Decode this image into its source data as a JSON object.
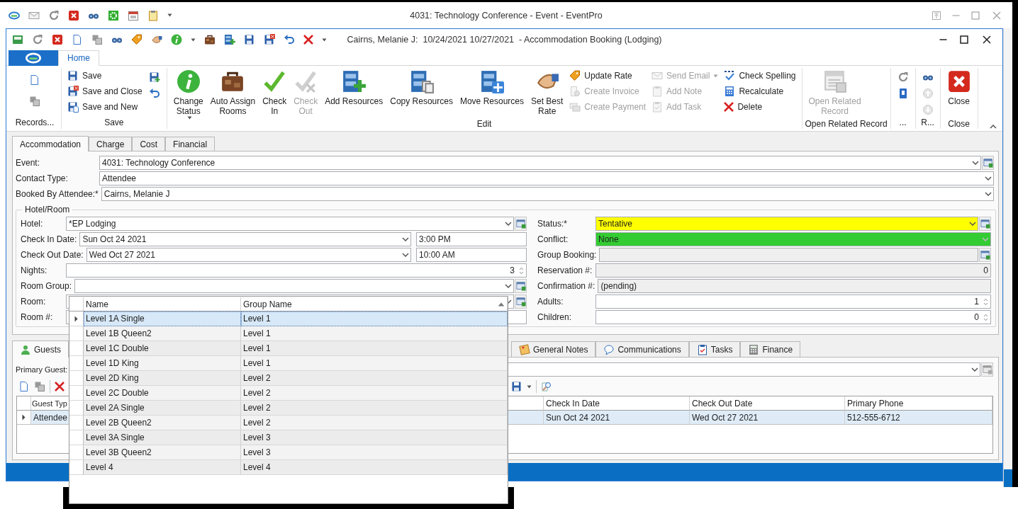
{
  "app_window": {
    "title": "4031: Technology Conference - Event - EventPro"
  },
  "booking_window": {
    "title": "Cairns, Melanie J:  10/24/2021 10/27/2021  - Accommodation Booking (Lodging)"
  },
  "ribbon_tabs": [
    {
      "label": "Home",
      "selected": true
    }
  ],
  "ribbon_groups": [
    {
      "label": "Records...",
      "columns": [
        [
          {
            "kind": "icon",
            "disabled": false
          },
          {
            "kind": "icon",
            "disabled": false
          }
        ]
      ]
    },
    {
      "label": "Save",
      "columns": [
        [
          {
            "kind": "small",
            "label": "Save",
            "disabled": false
          },
          {
            "kind": "small",
            "label": "Save and Close",
            "disabled": false
          },
          {
            "kind": "small",
            "label": "Save and New",
            "disabled": false
          }
        ],
        [
          {
            "kind": "icon",
            "disabled": false
          },
          {
            "kind": "icon",
            "disabled": false
          }
        ]
      ]
    },
    {
      "label": "Edit",
      "columns": [
        [
          {
            "kind": "large",
            "lines": [
              "Change",
              "Status"
            ],
            "menu": true,
            "disabled": false
          }
        ],
        [
          {
            "kind": "large",
            "lines": [
              "Auto Assign",
              "Rooms"
            ],
            "disabled": false
          }
        ],
        [
          {
            "kind": "large",
            "lines": [
              "Check",
              "In"
            ],
            "disabled": false
          }
        ],
        [
          {
            "kind": "large",
            "lines": [
              "Check",
              "Out"
            ],
            "disabled": true
          }
        ],
        [
          {
            "kind": "large",
            "lines": [
              "Add Resources"
            ],
            "disabled": false
          }
        ],
        [
          {
            "kind": "large",
            "lines": [
              "Copy Resources"
            ],
            "disabled": false
          }
        ],
        [
          {
            "kind": "large",
            "lines": [
              "Move Resources"
            ],
            "disabled": false
          }
        ],
        [
          {
            "kind": "large",
            "lines": [
              "Set Best",
              "Rate"
            ],
            "disabled": false
          }
        ],
        [
          {
            "kind": "small",
            "label": "Update Rate",
            "disabled": false
          },
          {
            "kind": "small",
            "label": "Create Invoice",
            "disabled": true
          },
          {
            "kind": "small",
            "label": "Create Payment",
            "disabled": true
          }
        ],
        [
          {
            "kind": "small",
            "label": "Send Email",
            "menu": true,
            "disabled": true
          },
          {
            "kind": "small",
            "label": "Add Note",
            "disabled": true
          },
          {
            "kind": "small",
            "label": "Add Task",
            "disabled": true
          }
        ],
        [
          {
            "kind": "small",
            "label": "Check Spelling",
            "disabled": false
          },
          {
            "kind": "small",
            "label": "Recalculate",
            "disabled": false
          },
          {
            "kind": "small",
            "label": "Delete",
            "disabled": false
          }
        ]
      ]
    },
    {
      "label": "Open Related Record",
      "columns": [
        [
          {
            "kind": "large",
            "lines": [
              "Open Related",
              "Record"
            ],
            "disabled": true
          }
        ]
      ]
    },
    {
      "label": "...",
      "columns": [
        [
          {
            "kind": "icon",
            "disabled": false
          },
          {
            "kind": "icon",
            "disabled": false
          }
        ]
      ]
    },
    {
      "label": "R...",
      "columns": [
        [
          {
            "kind": "icon",
            "disabled": false
          },
          {
            "kind": "icon",
            "disabled": true
          },
          {
            "kind": "icon",
            "disabled": true
          }
        ]
      ]
    },
    {
      "label": "Close",
      "columns": [
        [
          {
            "kind": "large",
            "lines": [
              "Close"
            ],
            "disabled": false
          }
        ]
      ]
    }
  ],
  "form_tabs": [
    {
      "label": "Accommodation",
      "selected": true
    },
    {
      "label": "Charge",
      "selected": false
    },
    {
      "label": "Cost",
      "selected": false
    },
    {
      "label": "Financial",
      "selected": false
    }
  ],
  "top_fields": [
    {
      "label": "Event:",
      "value": "4031: Technology Conference",
      "kind": "combo",
      "lookup": true
    },
    {
      "label": "Contact Type:",
      "value": "Attendee",
      "kind": "combo"
    },
    {
      "label": "Booked By Attendee:*",
      "value": "Cairns, Melanie J",
      "kind": "combo"
    }
  ],
  "hotel_room": {
    "title": "Hotel/Room",
    "left_fields": [
      {
        "label": "Hotel:",
        "value": "*EP Lodging",
        "kind": "combo",
        "lookup": true
      },
      {
        "label": "Check In Date:",
        "value": "Sun Oct 24 2021",
        "kind": "date",
        "time": "3:00 PM"
      },
      {
        "label": "Check Out Date:",
        "value": "Wed Oct 27 2021",
        "kind": "date",
        "time": "10:00 AM"
      },
      {
        "label": "Nights:",
        "value": "3",
        "kind": "spin"
      },
      {
        "label": "Room Group:",
        "kind": "combo",
        "lookup": true
      },
      {
        "label": "Room:",
        "kind": "combo",
        "lookup": true
      },
      {
        "label": "Room #:",
        "kind": "text"
      }
    ],
    "right_fields": [
      {
        "label": "Status:*",
        "value": "Tentative",
        "kind": "combo",
        "lookup": true,
        "color": "#ffff00"
      },
      {
        "label": "Conflict:",
        "value": "None",
        "kind": "combo",
        "readonly": true,
        "color": "#33cc33"
      },
      {
        "label": "Group Booking:",
        "kind": "text",
        "readonly": true,
        "lookup": true
      },
      {
        "label": "Reservation #:",
        "value": "0",
        "kind": "number",
        "readonly": true
      },
      {
        "label": "Confirmation #:",
        "value": "(pending)",
        "kind": "text",
        "readonly": true
      },
      {
        "label": "Adults:",
        "value": "1",
        "kind": "spin"
      },
      {
        "label": "Children:",
        "value": "0",
        "kind": "spin"
      }
    ]
  },
  "room_group_dropdown": {
    "columns": [
      {
        "label": "Name"
      },
      {
        "label": "Group Name",
        "sorted_ascending": true
      }
    ],
    "rows": [
      {
        "cells": [
          "Level 1A Single",
          "Level 1"
        ],
        "selected": true
      },
      {
        "cells": [
          "Level 1B Queen2",
          "Level 1"
        ],
        "selected": false
      },
      {
        "cells": [
          "Level 1C Double",
          "Level 1"
        ],
        "selected": false
      },
      {
        "cells": [
          "Level 1D King",
          "Level 1"
        ],
        "selected": false
      },
      {
        "cells": [
          "Level 2D King",
          "Level 2"
        ],
        "selected": false
      },
      {
        "cells": [
          "Level 2C Double",
          "Level 2"
        ],
        "selected": false
      },
      {
        "cells": [
          "Level 2A Single",
          "Level 2"
        ],
        "selected": false
      },
      {
        "cells": [
          "Level 2B Queen2",
          "Level 2"
        ],
        "selected": false
      },
      {
        "cells": [
          "Level 3A Single",
          "Level 3"
        ],
        "selected": false
      },
      {
        "cells": [
          "Level 3B Queen2",
          "Level 3"
        ],
        "selected": false
      },
      {
        "cells": [
          "Level 4",
          "Level 4"
        ],
        "selected": false
      }
    ]
  },
  "bottom_tabs": [
    {
      "label": "Guests",
      "selected": true
    },
    {
      "label": "General Notes",
      "selected": false
    },
    {
      "label": "Communications",
      "selected": false
    },
    {
      "label": "Tasks",
      "selected": false
    },
    {
      "label": "Finance",
      "selected": false
    }
  ],
  "guests": {
    "primary_guest_label": "Primary Guest:",
    "columns": [
      "Guest Typ",
      "Check In Date",
      "Check Out Date",
      "Primary Phone"
    ],
    "rows": [
      {
        "cells": [
          "Attendee",
          "Sun Oct 24 2021",
          "Wed Oct 27 2021",
          "512-555-6712"
        ],
        "selected": true
      }
    ]
  }
}
